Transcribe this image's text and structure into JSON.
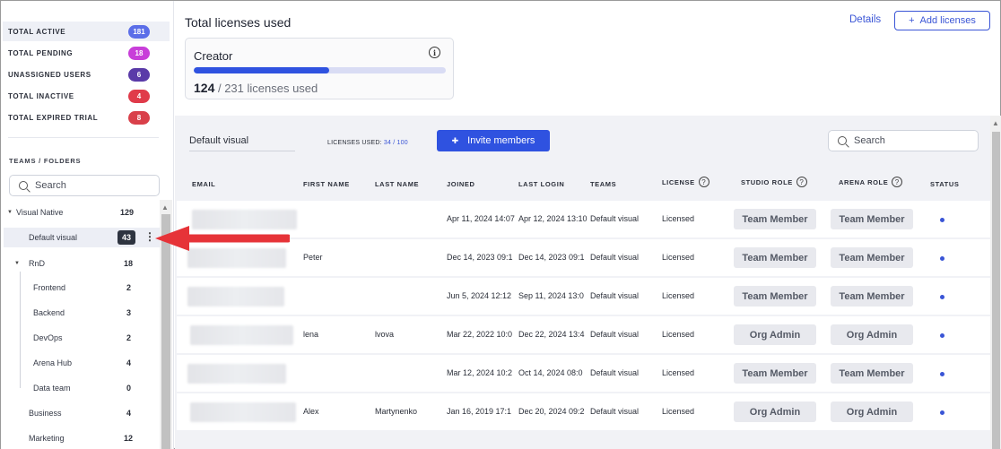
{
  "stats": [
    {
      "label": "TOTAL ACTIVE",
      "count": "181",
      "color": "#5b6ee8"
    },
    {
      "label": "TOTAL PENDING",
      "count": "18",
      "color": "#c83ed9"
    },
    {
      "label": "UNASSIGNED USERS",
      "count": "6",
      "color": "#5a3aa8"
    },
    {
      "label": "TOTAL INACTIVE",
      "count": "4",
      "color": "#e03b4a"
    },
    {
      "label": "TOTAL EXPIRED TRIAL",
      "count": "8",
      "color": "#d9404a"
    }
  ],
  "sidebar": {
    "section_title": "TEAMS / FOLDERS",
    "search_placeholder": "Search",
    "tree": [
      {
        "label": "Visual Native",
        "count": "129"
      },
      {
        "label": "Default visual",
        "count": "43"
      },
      {
        "label": "RnD",
        "count": "18"
      },
      {
        "label": "Frontend",
        "count": "2"
      },
      {
        "label": "Backend",
        "count": "3"
      },
      {
        "label": "DevOps",
        "count": "2"
      },
      {
        "label": "Arena Hub",
        "count": "4"
      },
      {
        "label": "Data team",
        "count": "0"
      },
      {
        "label": "Business",
        "count": "4"
      },
      {
        "label": "Marketing",
        "count": "12"
      }
    ]
  },
  "header": {
    "title": "Total licenses used",
    "details_label": "Details",
    "add_licenses_label": "Add licenses",
    "card": {
      "title": "Creator",
      "used": "124",
      "total_text": " / 231 licenses used",
      "progress_fraction": 0.537
    }
  },
  "main": {
    "team_name": "Default visual",
    "licenses_used_label": "LICENSES USED: ",
    "licenses_used_value": "34 / 100",
    "invite_label": "Invite members",
    "search_placeholder": "Search",
    "columns": {
      "email": "EMAIL",
      "first": "FIRST NAME",
      "last": "LAST NAME",
      "joined": "JOINED",
      "last_login": "LAST LOGIN",
      "teams": "TEAMS",
      "license": "LICENSE",
      "studio_role": "STUDIO ROLE",
      "arena_role": "ARENA ROLE",
      "status": "STATUS"
    },
    "rows": [
      {
        "first": "",
        "last": "",
        "joined": "Apr 11, 2024 14:07",
        "last_login": "Apr 12, 2024 13:10",
        "teams": "Default visual",
        "license": "Licensed",
        "studio_role": "Team Member",
        "arena_role": "Team Member"
      },
      {
        "first": "Peter",
        "last": "",
        "joined": "Dec 14, 2023 09:1",
        "last_login": "Dec 14, 2023 09:1",
        "teams": "Default visual",
        "license": "Licensed",
        "studio_role": "Team Member",
        "arena_role": "Team Member"
      },
      {
        "first": "",
        "last": "",
        "joined": "Jun 5, 2024 12:12",
        "last_login": "Sep 11, 2024 13:0",
        "teams": "Default visual",
        "license": "Licensed",
        "studio_role": "Team Member",
        "arena_role": "Team Member"
      },
      {
        "first": "lena",
        "last": "lvova",
        "joined": "Mar 22, 2022 10:0",
        "last_login": "Dec 22, 2024 13:4",
        "teams": "Default visual",
        "license": "Licensed",
        "studio_role": "Org Admin",
        "arena_role": "Org Admin"
      },
      {
        "first": "",
        "last": "",
        "joined": "Mar 12, 2024 10:2",
        "last_login": "Oct 14, 2024 08:0",
        "teams": "Default visual",
        "license": "Licensed",
        "studio_role": "Team Member",
        "arena_role": "Team Member"
      },
      {
        "first": "Alex",
        "last": "Martynenko",
        "joined": "Jan 16, 2019 17:1",
        "last_login": "Dec 20, 2024 09:2",
        "teams": "Default visual",
        "license": "Licensed",
        "studio_role": "Org Admin",
        "arena_role": "Org Admin"
      }
    ]
  }
}
